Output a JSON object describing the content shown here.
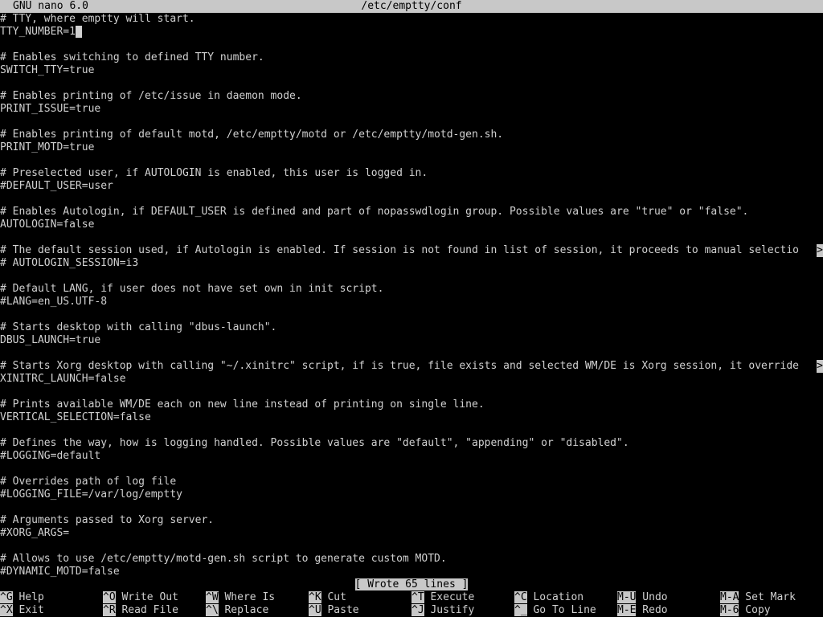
{
  "titlebar": {
    "app_name": "GNU nano 6.0",
    "file_path": "/etc/emptty/conf"
  },
  "editor": {
    "lines": [
      {
        "text": "# TTY, where emptty will start.",
        "more": false
      },
      {
        "text": "TTY_NUMBER=1",
        "more": false,
        "cursor": true
      },
      {
        "text": "",
        "more": false
      },
      {
        "text": "# Enables switching to defined TTY number.",
        "more": false
      },
      {
        "text": "SWITCH_TTY=true",
        "more": false
      },
      {
        "text": "",
        "more": false
      },
      {
        "text": "# Enables printing of /etc/issue in daemon mode.",
        "more": false
      },
      {
        "text": "PRINT_ISSUE=true",
        "more": false
      },
      {
        "text": "",
        "more": false
      },
      {
        "text": "# Enables printing of default motd, /etc/emptty/motd or /etc/emptty/motd-gen.sh.",
        "more": false
      },
      {
        "text": "PRINT_MOTD=true",
        "more": false
      },
      {
        "text": "",
        "more": false
      },
      {
        "text": "# Preselected user, if AUTOLOGIN is enabled, this user is logged in.",
        "more": false
      },
      {
        "text": "#DEFAULT_USER=user",
        "more": false
      },
      {
        "text": "",
        "more": false
      },
      {
        "text": "# Enables Autologin, if DEFAULT_USER is defined and part of nopasswdlogin group. Possible values are \"true\" or \"false\".",
        "more": false
      },
      {
        "text": "AUTOLOGIN=false",
        "more": false
      },
      {
        "text": "",
        "more": false
      },
      {
        "text": "# The default session used, if Autologin is enabled. If session is not found in list of session, it proceeds to manual selectio",
        "more": true
      },
      {
        "text": "# AUTOLOGIN_SESSION=i3",
        "more": false
      },
      {
        "text": "",
        "more": false
      },
      {
        "text": "# Default LANG, if user does not have set own in init script.",
        "more": false
      },
      {
        "text": "#LANG=en_US.UTF-8",
        "more": false
      },
      {
        "text": "",
        "more": false
      },
      {
        "text": "# Starts desktop with calling \"dbus-launch\".",
        "more": false
      },
      {
        "text": "DBUS_LAUNCH=true",
        "more": false
      },
      {
        "text": "",
        "more": false
      },
      {
        "text": "# Starts Xorg desktop with calling \"~/.xinitrc\" script, if is true, file exists and selected WM/DE is Xorg session, it override",
        "more": true
      },
      {
        "text": "XINITRC_LAUNCH=false",
        "more": false
      },
      {
        "text": "",
        "more": false
      },
      {
        "text": "# Prints available WM/DE each on new line instead of printing on single line.",
        "more": false
      },
      {
        "text": "VERTICAL_SELECTION=false",
        "more": false
      },
      {
        "text": "",
        "more": false
      },
      {
        "text": "# Defines the way, how is logging handled. Possible values are \"default\", \"appending\" or \"disabled\".",
        "more": false
      },
      {
        "text": "#LOGGING=default",
        "more": false
      },
      {
        "text": "",
        "more": false
      },
      {
        "text": "# Overrides path of log file",
        "more": false
      },
      {
        "text": "#LOGGING_FILE=/var/log/emptty",
        "more": false
      },
      {
        "text": "",
        "more": false
      },
      {
        "text": "# Arguments passed to Xorg server.",
        "more": false
      },
      {
        "text": "#XORG_ARGS=",
        "more": false
      },
      {
        "text": "",
        "more": false
      },
      {
        "text": "# Allows to use /etc/emptty/motd-gen.sh script to generate custom MOTD.",
        "more": false
      },
      {
        "text": "#DYNAMIC_MOTD=false",
        "more": false
      }
    ],
    "more_marker": ">"
  },
  "status": {
    "message": "[ Wrote 65 lines ]"
  },
  "shortcuts": [
    {
      "key": "^G",
      "label": "Help"
    },
    {
      "key": "^X",
      "label": "Exit"
    },
    {
      "key": "^O",
      "label": "Write Out"
    },
    {
      "key": "^R",
      "label": "Read File"
    },
    {
      "key": "^W",
      "label": "Where Is"
    },
    {
      "key": "^\\",
      "label": "Replace"
    },
    {
      "key": "^K",
      "label": "Cut"
    },
    {
      "key": "^U",
      "label": "Paste"
    },
    {
      "key": "^T",
      "label": "Execute"
    },
    {
      "key": "^J",
      "label": "Justify"
    },
    {
      "key": "^C",
      "label": "Location"
    },
    {
      "key": "^_",
      "label": "Go To Line"
    },
    {
      "key": "M-U",
      "label": "Undo"
    },
    {
      "key": "M-E",
      "label": "Redo"
    },
    {
      "key": "M-A",
      "label": "Set Mark"
    },
    {
      "key": "M-6",
      "label": "Copy"
    }
  ]
}
